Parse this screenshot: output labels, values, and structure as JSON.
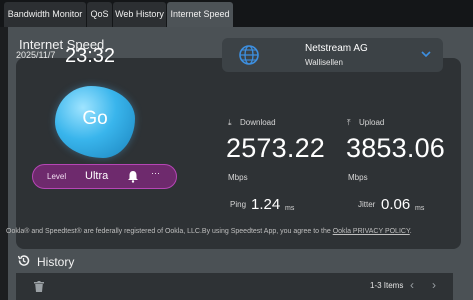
{
  "tabs": [
    "Bandwidth Monitor",
    "QoS",
    "Web History",
    "Internet Speed"
  ],
  "panel_title": "Internet Speed",
  "datetime": {
    "date": "2025/11/7",
    "time": "23:32"
  },
  "server": {
    "name": "Netstream AG",
    "city": "Wallisellen",
    "icon": "globe-icon"
  },
  "go_label": "Go",
  "download": {
    "label": "Download",
    "value": "2573.22",
    "unit": "Mbps"
  },
  "upload": {
    "label": "Upload",
    "value": "3853.06",
    "unit": "Mbps"
  },
  "level": {
    "label": "Level",
    "value": "Ultra",
    "more": "···"
  },
  "ping": {
    "label": "Ping",
    "value": "1.24",
    "unit": "ms"
  },
  "jitter": {
    "label": "Jitter",
    "value": "0.06",
    "unit": "ms"
  },
  "notice": {
    "text": "Ookla® and Speedtest® are federally registered of Ookla, LLC.By using Speedtest App, you agree to the ",
    "link": "Ookla PRIVACY POLICY",
    "end": "."
  },
  "history": {
    "title": "History",
    "items_text": "1-3 Items",
    "prev": "‹",
    "next": "›"
  },
  "colors": {
    "accent_go": "#39b5ec",
    "level_bg": "#6e2a6d",
    "level_border": "#b646b5"
  }
}
